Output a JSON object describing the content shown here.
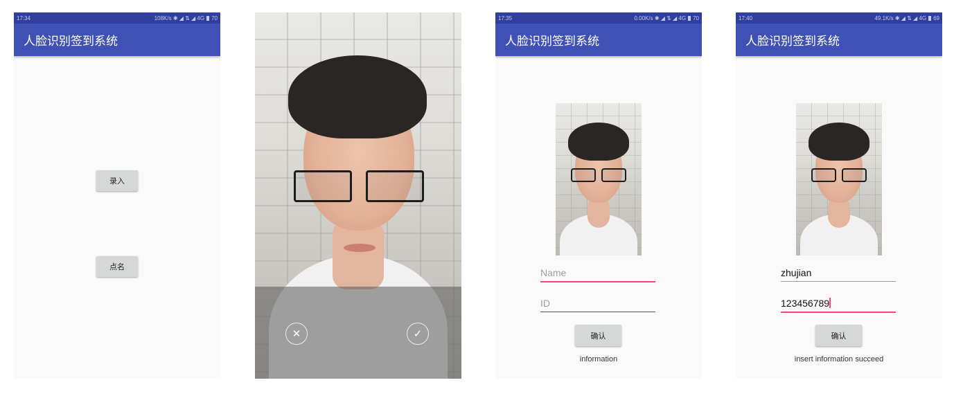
{
  "app": {
    "title": "人脸识别签到系统"
  },
  "screens": [
    {
      "status": {
        "time": "17:34",
        "right": "108K/s ✱ ◢ ⇅ ◢ 4G",
        "battery": "70"
      },
      "buttons": {
        "enroll": "录入",
        "rollcall": "点名"
      }
    },
    {
      "camera": {
        "cancel_icon": "close-icon",
        "confirm_icon": "check-icon"
      }
    },
    {
      "status": {
        "time": "17:35",
        "right": "0.00K/s ✱ ◢ ⇅ ◢ 4G",
        "battery": "70"
      },
      "form": {
        "name_placeholder": "Name",
        "id_placeholder": "ID",
        "confirm": "确认",
        "message": "information"
      }
    },
    {
      "status": {
        "time": "17:40",
        "right": "49.1K/s ✱ ◢ ⇅ ◢ 4G",
        "battery": "69"
      },
      "form": {
        "name_value": "zhujian",
        "id_value": "123456789",
        "confirm": "确认",
        "message": "insert information succeed"
      }
    }
  ],
  "colors": {
    "primary": "#3f51b5",
    "primary_dark": "#303f9f",
    "accent": "#ff4081"
  }
}
